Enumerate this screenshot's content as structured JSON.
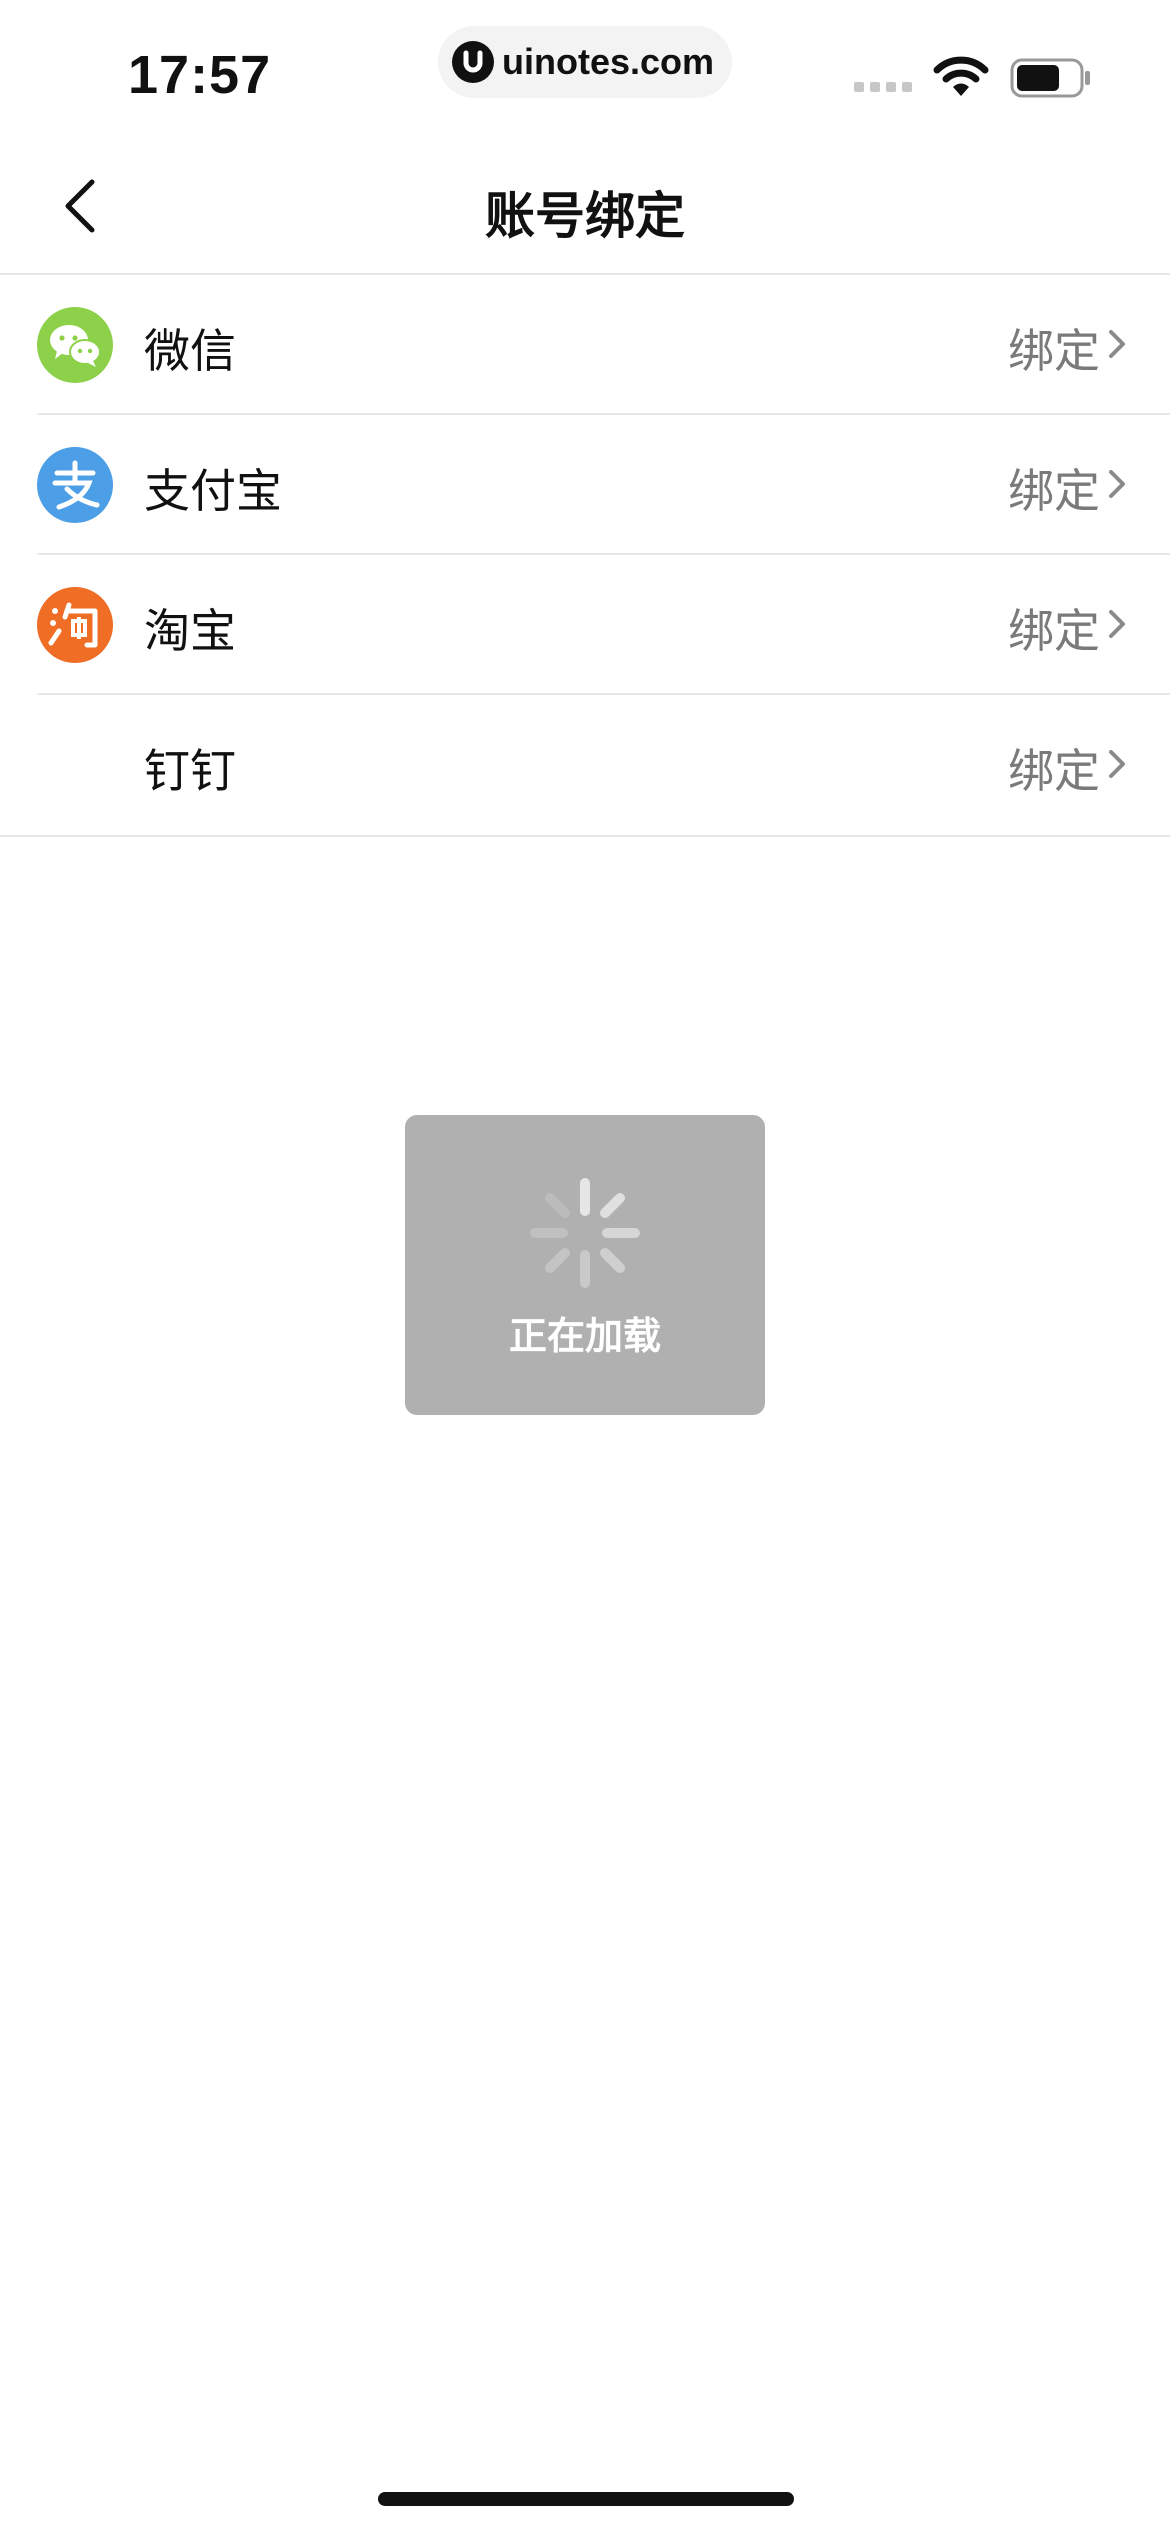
{
  "status_bar": {
    "time": "17:57",
    "url": "uinotes.com"
  },
  "nav": {
    "title": "账号绑定",
    "back_icon": "chevron-left-icon"
  },
  "accounts": [
    {
      "label": "微信",
      "status": "绑定",
      "icon": "wechat-icon",
      "color": "#8dd14a"
    },
    {
      "label": "支付宝",
      "status": "绑定",
      "icon": "alipay-icon",
      "color": "#4c9ee6"
    },
    {
      "label": "淘宝",
      "status": "绑定",
      "icon": "taobao-icon",
      "color": "#ef6d25"
    },
    {
      "label": "钉钉",
      "status": "绑定",
      "icon": "",
      "color": ""
    }
  ],
  "loading": {
    "text": "正在加载",
    "icon": "spinner-icon"
  },
  "icon_glyphs": {
    "alipay": "支",
    "taobao": "淘"
  }
}
